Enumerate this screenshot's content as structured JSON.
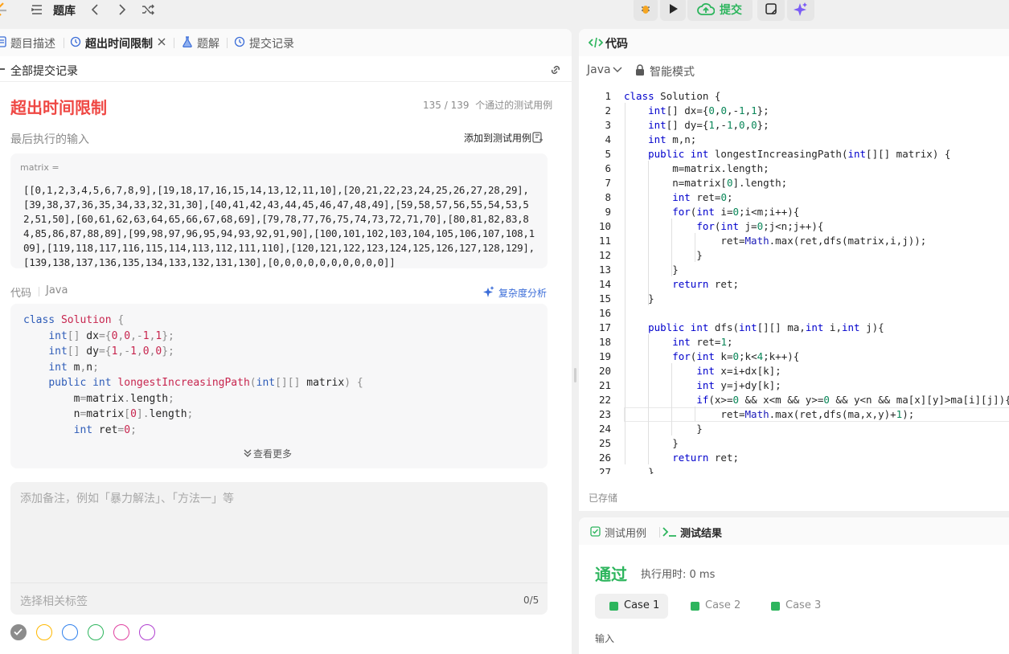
{
  "topbar": {
    "nav_title": "题库",
    "submit_label": "提交",
    "colors": {
      "accent_green": "#2db55d",
      "danger_red": "#ef4743"
    }
  },
  "tabs": [
    {
      "label": "题目描述",
      "icon": "description-icon"
    },
    {
      "label": "超出时间限制",
      "icon": "history-icon"
    },
    {
      "label": "题解",
      "icon": "flask-icon"
    },
    {
      "label": "提交记录",
      "icon": "history-icon"
    }
  ],
  "back_label": "全部提交记录",
  "submission": {
    "status": "超出时间限制",
    "passed": "135 / 139",
    "passed_suffix": "个通过的测试用例",
    "last_input_label": "最后执行的输入",
    "add_testcase": "添加到测试用例",
    "input_var": "matrix =",
    "input_value": "[[0,1,2,3,4,5,6,7,8,9],[19,18,17,16,15,14,13,12,11,10],[20,21,22,23,24,25,26,27,28,29],[39,38,37,36,35,34,33,32,31,30],[40,41,42,43,44,45,46,47,48,49],[59,58,57,56,55,54,53,52,51,50],[60,61,62,63,64,65,66,67,68,69],[79,78,77,76,75,74,73,72,71,70],[80,81,82,83,84,85,86,87,88,89],[99,98,97,96,95,94,93,92,91,90],[100,101,102,103,104,105,106,107,108,109],[119,118,117,116,115,114,113,112,111,110],[120,121,122,123,124,125,126,127,128,129],[139,138,137,136,135,134,133,132,131,130],[0,0,0,0,0,0,0,0,0,0]]",
    "code_label": "代码",
    "code_lang": "Java",
    "complexity_btn": "复杂度分析",
    "view_more": "查看更多",
    "note_placeholder": "添加备注，例如「暴力解法」、「方法一」等",
    "tag_placeholder": "选择相关标签",
    "tag_count": "0/5",
    "tag_colors": [
      "#8c8c8c",
      "#ffb800",
      "#2f80ed",
      "#2db55d",
      "#e040a0",
      "#b040d0"
    ]
  },
  "editor": {
    "title": "代码",
    "language": "Java",
    "mode": "智能模式",
    "saved": "已存储",
    "current_line": 23
  },
  "result": {
    "tab_testcase": "测试用例",
    "tab_result": "测试结果",
    "status": "通过",
    "runtime": "执行用时: 0 ms",
    "cases": [
      "Case 1",
      "Case 2",
      "Case 3"
    ],
    "active_case": 0,
    "input_label": "输入"
  }
}
